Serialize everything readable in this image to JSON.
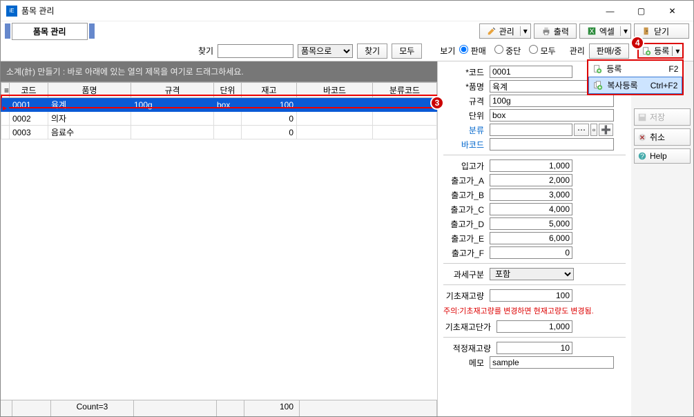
{
  "window": {
    "title": "품목 관리"
  },
  "page_title": "품목 관리",
  "toolbar": {
    "manage": "관리",
    "print": "출력",
    "excel": "엑셀",
    "close": "닫기"
  },
  "search": {
    "label": "찾기",
    "value": "",
    "field_options": [
      "품목으로"
    ],
    "field_selected": "품목으로",
    "find_btn": "찾기",
    "all_btn": "모두"
  },
  "view": {
    "label": "보기",
    "options": {
      "sale": "판매",
      "stop": "중단",
      "all": "모두"
    },
    "selected": "판매"
  },
  "admin": {
    "label": "관리",
    "sale_stop_btn": "판매/중"
  },
  "register": {
    "btn": "등록",
    "menu": [
      {
        "label": "등록",
        "shortcut": "F2"
      },
      {
        "label": "복사등록",
        "shortcut": "Ctrl+F2"
      }
    ]
  },
  "side": {
    "save": "저장",
    "cancel": "취소",
    "help": "Help"
  },
  "grid": {
    "group_hint": "소계(計) 만들기 : 바로 아래에 있는 열의 제목을 여기로 드래그하세요.",
    "cols": [
      "코드",
      "품명",
      "규격",
      "단위",
      "재고",
      "바코드",
      "분류코드"
    ],
    "rows": [
      {
        "code": "0001",
        "name": "육계",
        "spec": "100g",
        "unit": "box",
        "stock": "100",
        "barcode": "",
        "cat": ""
      },
      {
        "code": "0002",
        "name": "의자",
        "spec": "",
        "unit": "",
        "stock": "0",
        "barcode": "",
        "cat": ""
      },
      {
        "code": "0003",
        "name": "음료수",
        "spec": "",
        "unit": "",
        "stock": "0",
        "barcode": "",
        "cat": ""
      }
    ],
    "footer": {
      "count_label": "Count=3",
      "stock_sum": "100"
    }
  },
  "detail": {
    "labels": {
      "code": "*코드",
      "name": "*품명",
      "spec": "규격",
      "unit": "단위",
      "cat": "분류",
      "barcode": "바코드",
      "in_price": "입고가",
      "out_a": "출고가_A",
      "out_b": "출고가_B",
      "out_c": "출고가_C",
      "out_d": "출고가_D",
      "out_e": "출고가_E",
      "out_f": "출고가_F",
      "tax": "과세구분",
      "init_stock": "기초재고량",
      "init_price": "기초재고단가",
      "safe_stock": "적정재고량",
      "memo": "메모"
    },
    "values": {
      "code": "0001",
      "name": "육계",
      "spec": "100g",
      "unit": "box",
      "cat": "",
      "barcode": "",
      "in_price": "1,000",
      "out_a": "2,000",
      "out_b": "3,000",
      "out_c": "4,000",
      "out_d": "5,000",
      "out_e": "6,000",
      "out_f": "0",
      "tax": "포함",
      "init_stock": "100",
      "init_price": "1,000",
      "safe_stock": "10",
      "memo": "sample"
    },
    "warn": "주의:기초재고량를 변경하면 현재고량도 변경됨.",
    "code_checked": true
  },
  "badges": {
    "b3": "3",
    "b4": "4"
  }
}
